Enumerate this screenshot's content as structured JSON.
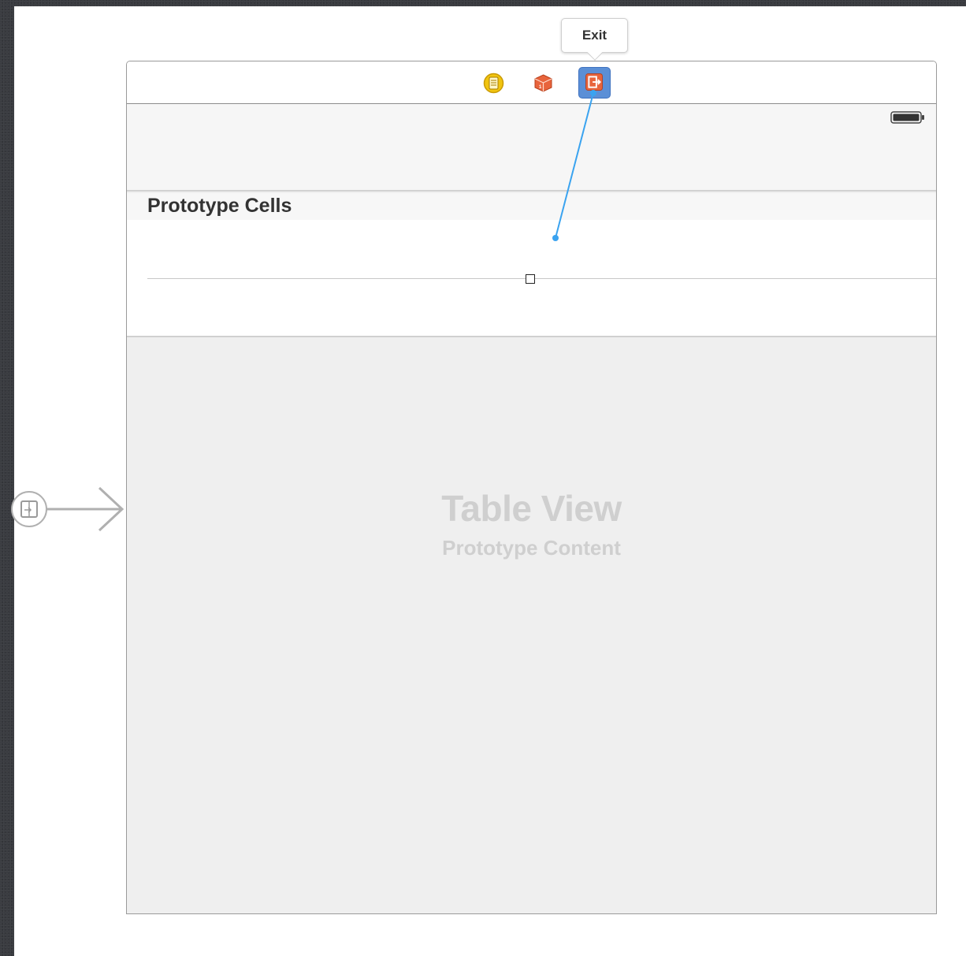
{
  "tooltip": {
    "label": "Exit"
  },
  "scene": {
    "dock": {
      "icons": [
        "view-controller-icon",
        "first-responder-icon",
        "exit-icon"
      ]
    },
    "section_header": "Prototype Cells",
    "placeholder": {
      "title": "Table View",
      "subtitle": "Prototype Content"
    }
  },
  "colors": {
    "canvas_bg": "#ffffff",
    "desktop_bg": "#3a3c41",
    "exit_selected": "#5b8fd6",
    "connection_line": "#3aa3f0",
    "first_responder": "#e8643c",
    "view_controller": "#f1c40f",
    "placeholder_text": "#cfcfcf"
  }
}
